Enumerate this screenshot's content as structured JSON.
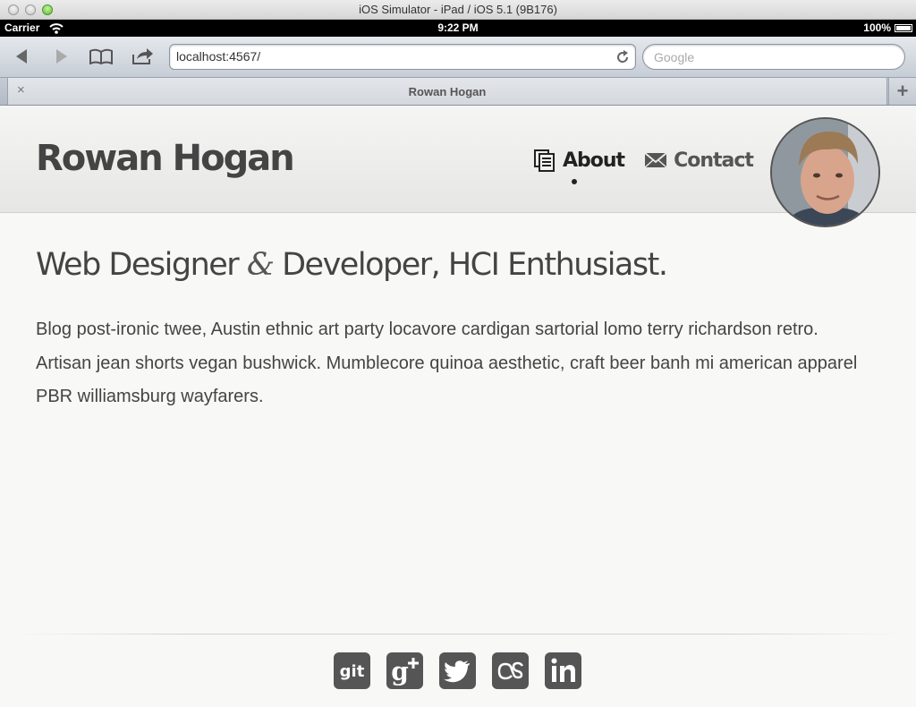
{
  "window": {
    "title": "iOS Simulator - iPad / iOS 5.1 (9B176)"
  },
  "status_bar": {
    "carrier": "Carrier",
    "time": "9:22 PM",
    "battery": "100%"
  },
  "browser": {
    "url": "localhost:4567/",
    "search_placeholder": "Google",
    "tab_title": "Rowan Hogan",
    "new_tab_label": "+",
    "close_tab_label": "×"
  },
  "site": {
    "brand": "Rowan Hogan",
    "nav": [
      {
        "label": "About",
        "icon": "documents-icon",
        "active": true
      },
      {
        "label": "Contact",
        "icon": "envelope-icon",
        "active": false
      }
    ],
    "headline_part1": "Web Designer ",
    "headline_amp": "&",
    "headline_part2": " Developer, HCI Enthusiast.",
    "body": "Blog post-ironic twee, Austin ethnic art party locavore cardigan sartorial lomo terry richardson retro. Artisan jean shorts vegan bushwick. Mumblecore quinoa aesthetic, craft beer banh mi american apparel PBR williamsburg wayfarers.",
    "social": [
      {
        "name": "github",
        "label": "git"
      },
      {
        "name": "google-plus",
        "label": "g+"
      },
      {
        "name": "twitter",
        "label": ""
      },
      {
        "name": "lastfm",
        "label": "as"
      },
      {
        "name": "linkedin",
        "label": "in"
      }
    ]
  },
  "colors": {
    "text": "#444444",
    "icon_bg": "#555555",
    "page_bg": "#f8f8f7"
  }
}
